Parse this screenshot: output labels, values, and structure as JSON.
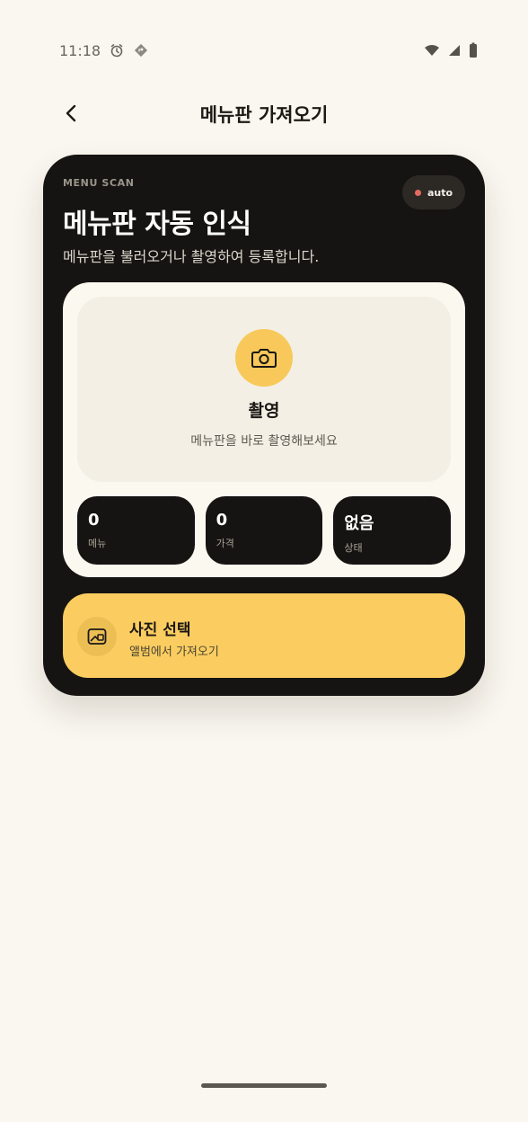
{
  "status_bar": {
    "time": "11:18"
  },
  "app_bar": {
    "title": "메뉴판 가져오기"
  },
  "hero": {
    "eyebrow": "MENU SCAN",
    "badge": "auto",
    "title": "메뉴판 자동 인식",
    "subtitle": "메뉴판을 불러오거나 촬영하여 등록합니다."
  },
  "capture": {
    "label": "촬영",
    "hint": "메뉴판을 바로 촬영해보세요"
  },
  "stats": [
    {
      "value": "0",
      "label": "메뉴"
    },
    {
      "value": "0",
      "label": "가격"
    },
    {
      "value": "없음",
      "label": "상태"
    }
  ],
  "photo_select": {
    "title": "사진 선택",
    "subtitle": "앨범에서 가져오기"
  },
  "colors": {
    "background": "#faf7f0",
    "card_dark": "#161412",
    "accent_yellow": "#fbcd60",
    "camera_yellow": "#f8c95a",
    "badge_dot": "#e46a5e"
  },
  "icons": {
    "status_left": [
      "alarm-icon",
      "location-diamond-icon"
    ],
    "status_right": [
      "wifi-icon",
      "signal-icon",
      "battery-icon"
    ],
    "back": "back-chevron-icon",
    "capture": "camera-icon",
    "gallery": "gallery-icon"
  }
}
